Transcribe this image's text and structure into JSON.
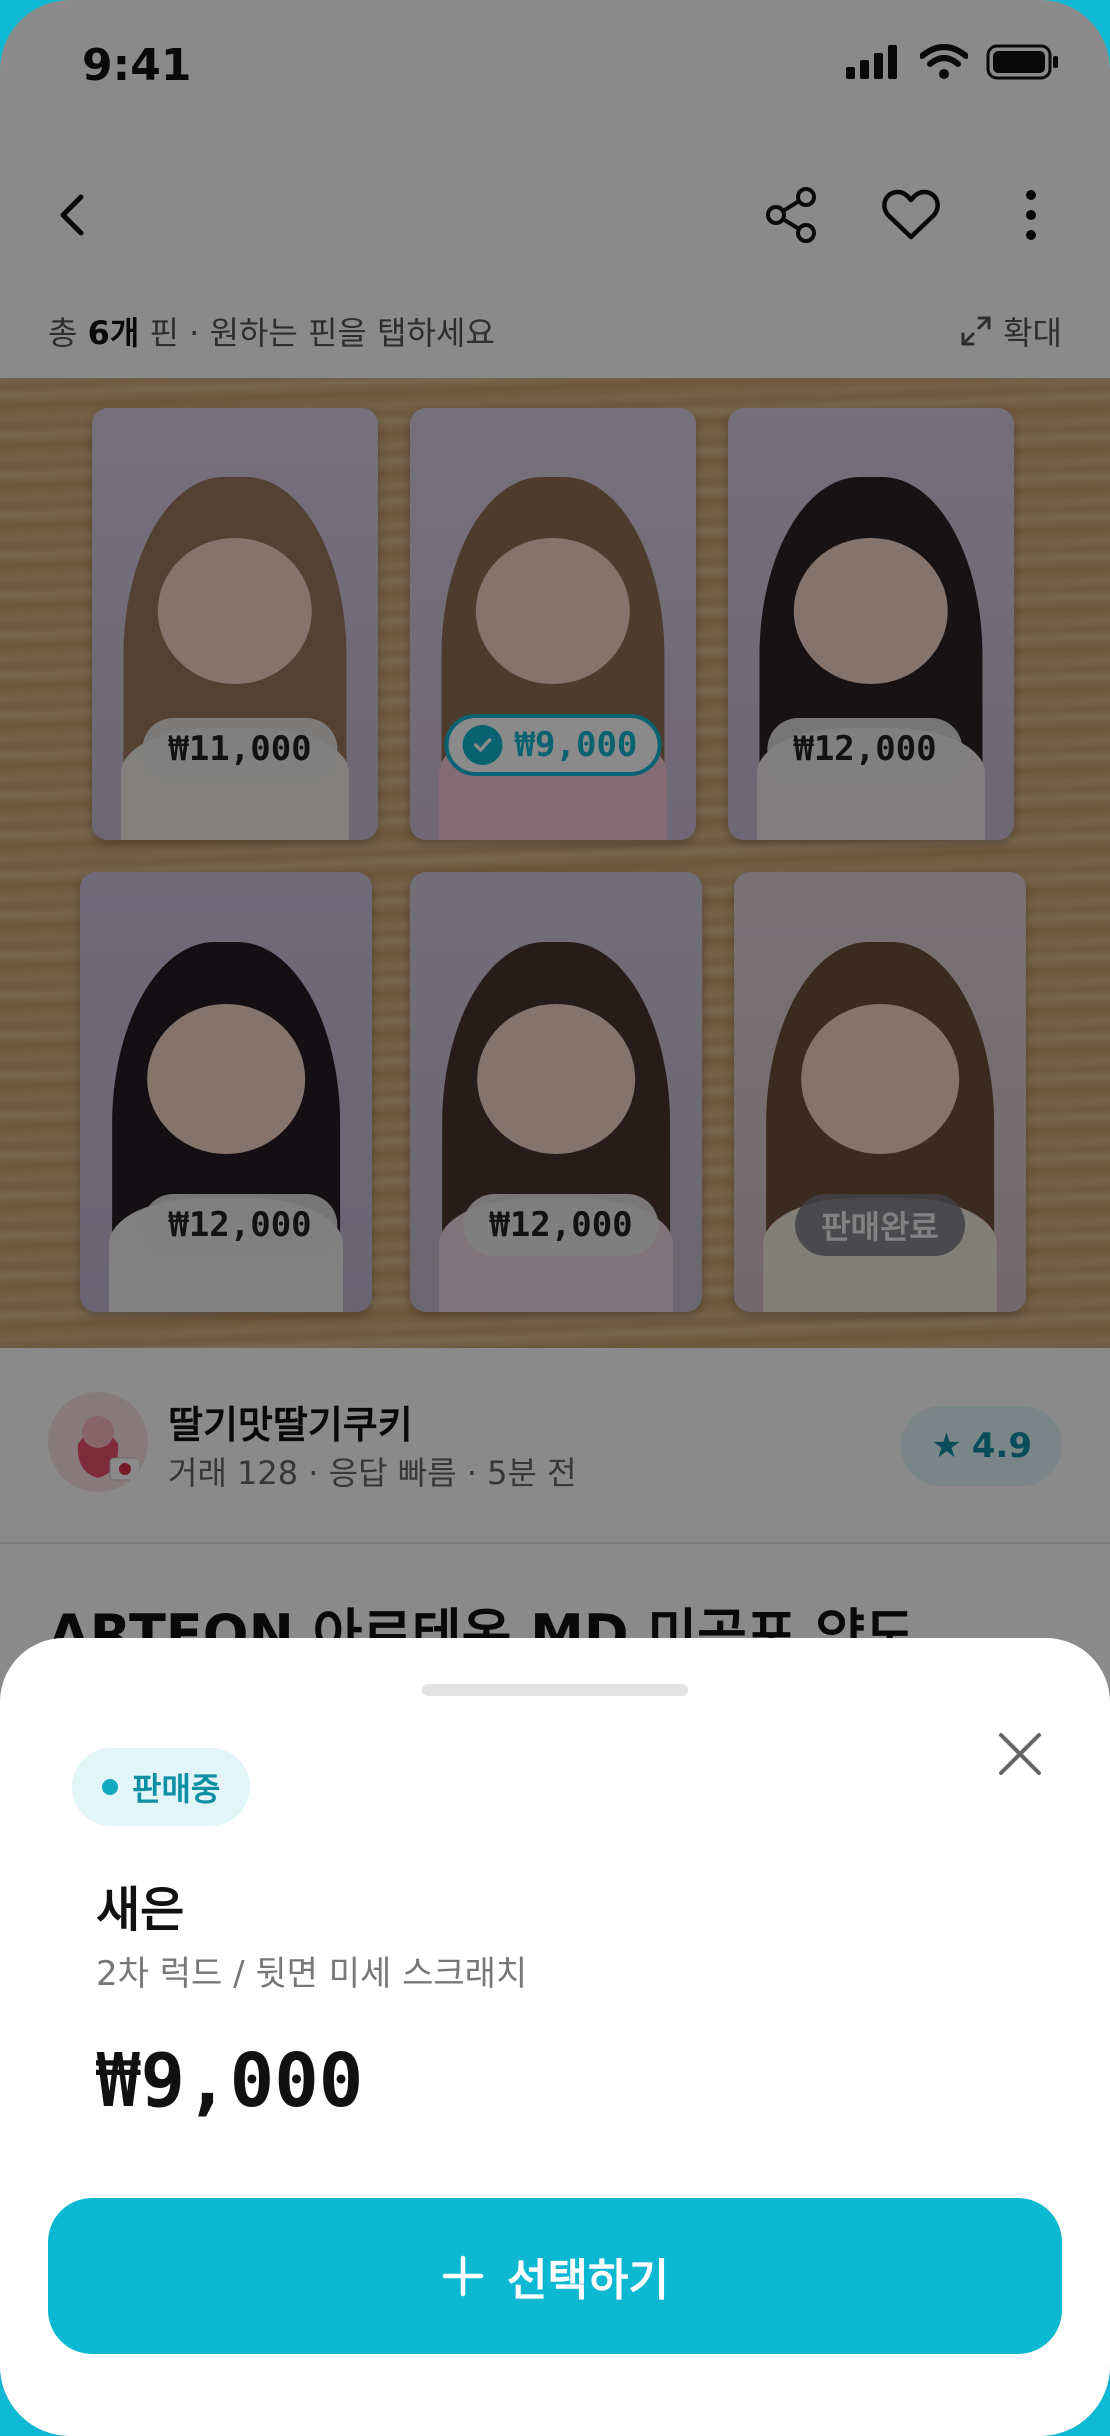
{
  "status_bar": {
    "time": "9:41"
  },
  "header": {
    "back_icon": "chevron-left-icon",
    "share_icon": "share-icon",
    "like_icon": "heart-icon",
    "more_icon": "more-vertical-icon"
  },
  "count_row": {
    "prefix": "총",
    "count": "6개",
    "suffix": "핀 · 원하는 핀을 탭하세요",
    "expand_label": "확대"
  },
  "pins": [
    {
      "price": "₩11,000",
      "state": "available"
    },
    {
      "price": "₩9,000",
      "state": "selected"
    },
    {
      "price": "₩12,000",
      "state": "available"
    },
    {
      "price": "₩12,000",
      "state": "available"
    },
    {
      "price": "₩12,000",
      "state": "available"
    },
    {
      "price": "판매완료",
      "state": "sold"
    }
  ],
  "seller": {
    "name": "딸기맛딸기쿠키",
    "meta": "거래 128 · 응답 빠름 · 5분 전",
    "rating": "4.9"
  },
  "product": {
    "title": "ARTEON 아르테온 MD 미공포 양도"
  },
  "sheet": {
    "status_label": "판매중",
    "condition": "새은",
    "condition_detail": "2차 럭드 / 뒷면 미세 스크래치",
    "price": "₩9,000",
    "cta_label": "선택하기"
  },
  "colors": {
    "accent": "#0db8d3",
    "accent_dark": "#0f8fa4"
  }
}
